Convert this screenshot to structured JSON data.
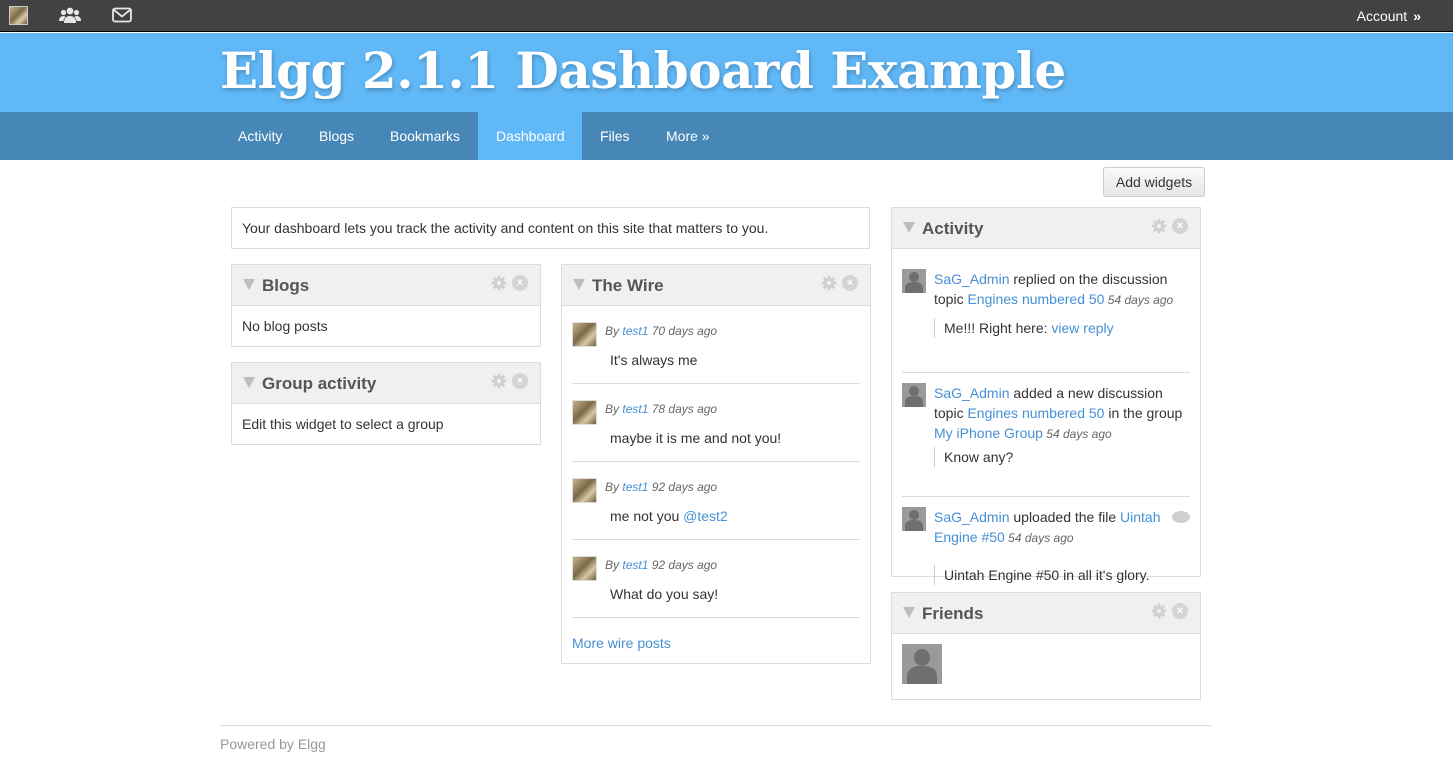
{
  "topbar": {
    "icons": [
      "user-avatar-icon",
      "groups-icon",
      "mail-icon"
    ],
    "account_label": "Account",
    "account_chevron": "»"
  },
  "header": {
    "title": "Elgg 2.1.1 Dashboard Example"
  },
  "nav": {
    "items": [
      {
        "label": "Activity"
      },
      {
        "label": "Blogs"
      },
      {
        "label": "Bookmarks"
      },
      {
        "label": "Dashboard",
        "active": true
      },
      {
        "label": "Files"
      },
      {
        "label": "More »"
      }
    ]
  },
  "add_widgets_label": "Add widgets",
  "intro": "Your dashboard lets you track the activity and content on this site that matters to you.",
  "widgets": {
    "blogs": {
      "title": "Blogs",
      "body": "No blog posts"
    },
    "group_activity": {
      "title": "Group activity",
      "body": "Edit this widget to select a group"
    },
    "wire": {
      "title": "The Wire",
      "by_prefix": "By",
      "posts": [
        {
          "user": "test1",
          "time": "70 days ago",
          "message": "It's always me"
        },
        {
          "user": "test1",
          "time": "78 days ago",
          "message": "maybe it is me and not you!"
        },
        {
          "user": "test1",
          "time": "92 days ago",
          "message": "me not you ",
          "mention": "@test2"
        },
        {
          "user": "test1",
          "time": "92 days ago",
          "message": "What do you say!"
        }
      ],
      "more_link": "More wire posts"
    },
    "activity": {
      "title": "Activity",
      "items": [
        {
          "user": "SaG_Admin",
          "action1": " replied on the discussion topic ",
          "target": "Engines numbered 50",
          "time": " 54 days ago",
          "excerpt": "Me!!! Right here: ",
          "excerpt_link": "view reply"
        },
        {
          "user": "SaG_Admin",
          "action1": " added a new discussion topic ",
          "target": "Engines numbered 50",
          "action2": " in the group ",
          "group": "My iPhone Group",
          "time": " 54 days ago",
          "excerpt": "Know any?"
        },
        {
          "user": "SaG_Admin",
          "action1": " uploaded the file ",
          "target": "Uintah Engine #50",
          "time": " 54 days ago",
          "excerpt": "Uintah Engine #50 in all it's glory."
        }
      ]
    },
    "friends": {
      "title": "Friends"
    }
  },
  "footer": {
    "text": "Powered by Elgg"
  },
  "colors": {
    "topbar": "#424242",
    "header": "#60b8f7",
    "nav": "#4787b8",
    "nav_active": "#60b8f7",
    "link": "#4690d6"
  }
}
